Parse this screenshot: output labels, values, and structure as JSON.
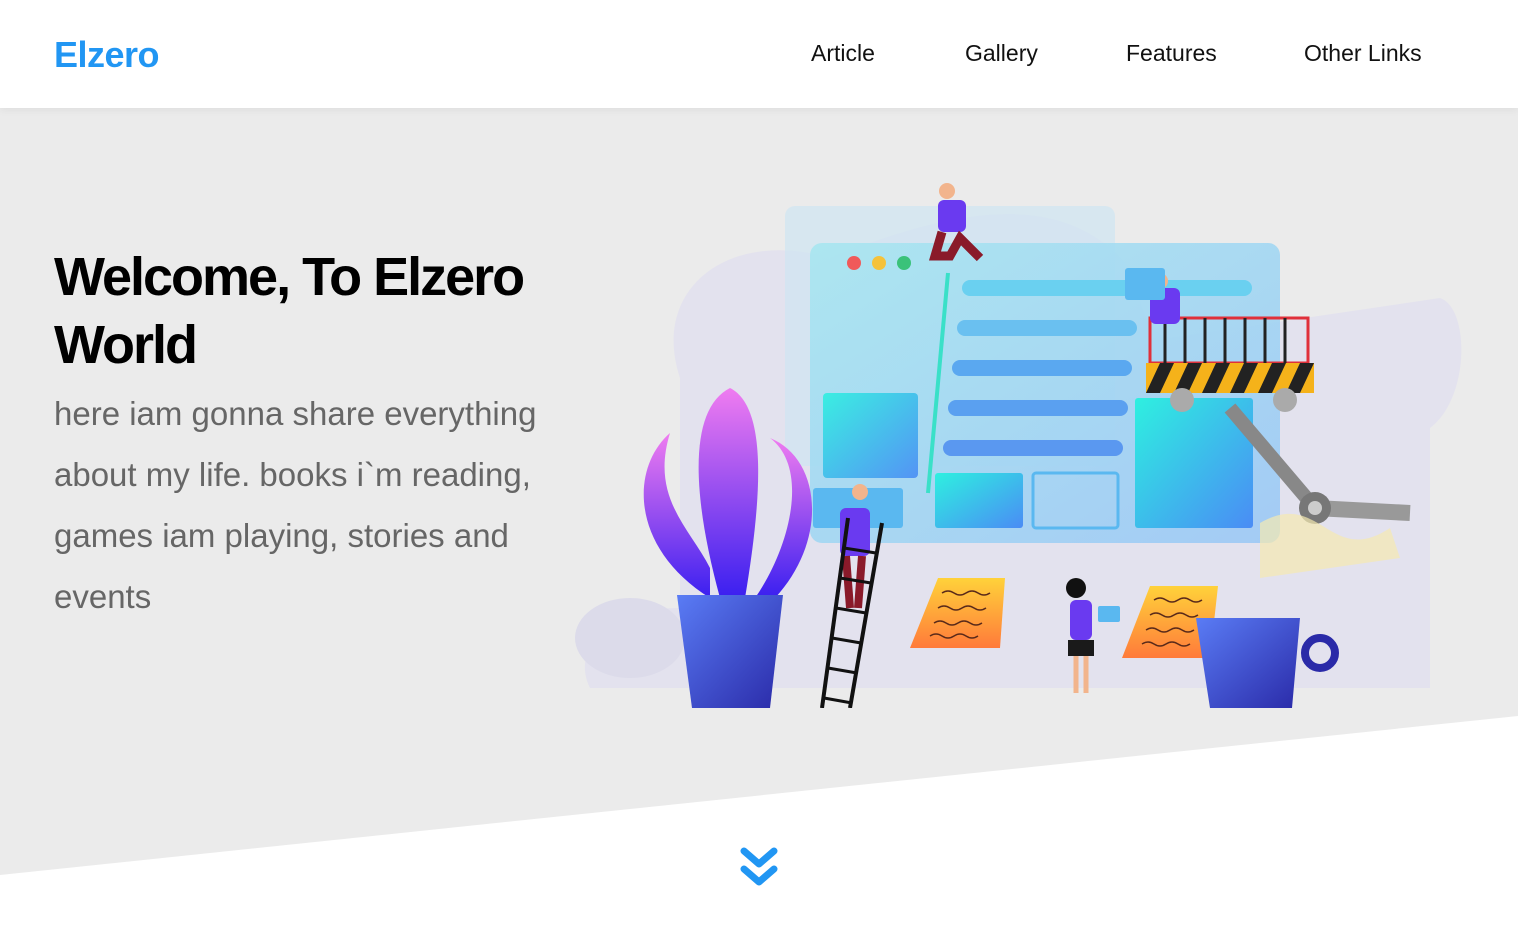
{
  "header": {
    "logo": "Elzero",
    "nav": [
      {
        "label": "Article"
      },
      {
        "label": "Gallery"
      },
      {
        "label": "Features"
      },
      {
        "label": "Other Links"
      }
    ]
  },
  "hero": {
    "title": "Welcome, To Elzero World",
    "text": "here iam gonna share everything about my life. books i`m reading, games iam playing, stories and events"
  },
  "colors": {
    "brand": "#2196f3",
    "hero_bg": "#ebebeb",
    "heading": "#000000",
    "body_text": "#666666"
  },
  "icons": {
    "scroll_down": "double-chevron-down-icon"
  }
}
